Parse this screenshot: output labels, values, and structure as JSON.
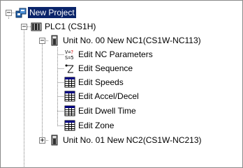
{
  "tree": {
    "root": {
      "label": "New Project",
      "icon": "project-icon",
      "selected": true,
      "expanded": true
    },
    "plc": {
      "label": "PLC1 (CS1H)",
      "icon": "plc-icon",
      "expanded": true
    },
    "units": [
      {
        "label": "Unit No. 00 New NC1(CS1W-NC113)",
        "icon": "unit-icon",
        "expanded": true,
        "children": [
          {
            "label": "Edit NC Parameters",
            "icon": "nc-parameters-icon"
          },
          {
            "label": "Edit Sequence",
            "icon": "sequence-icon"
          },
          {
            "label": "Edit Speeds",
            "icon": "table-icon"
          },
          {
            "label": "Edit Accel/Decel",
            "icon": "table-icon"
          },
          {
            "label": "Edit Dwell Time",
            "icon": "table-icon"
          },
          {
            "label": "Edit Zone",
            "icon": "table-icon"
          }
        ]
      },
      {
        "label": "Unit No. 01 New NC2(CS1W-NC213)",
        "icon": "unit-icon",
        "expanded": false
      }
    ]
  },
  "expander_symbols": {
    "expanded": "−",
    "collapsed": "+"
  },
  "colors": {
    "selection": "#0a246a",
    "tree_lines": "#808080",
    "frame_border": "#8a8a8a"
  }
}
